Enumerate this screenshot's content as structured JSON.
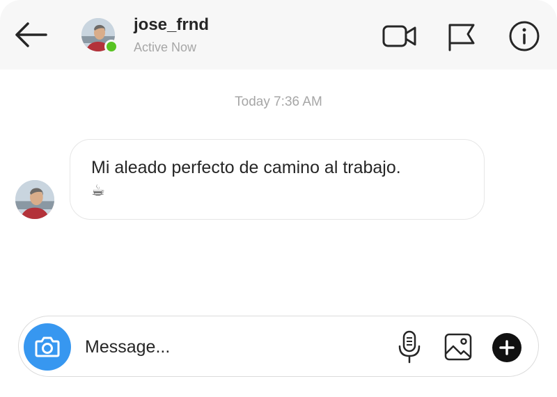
{
  "header": {
    "username": "jose_frnd",
    "status": "Active Now",
    "icons": {
      "back": "arrow-left-icon",
      "video": "video-camera-icon",
      "flag": "flag-icon",
      "info": "info-icon"
    },
    "online_color": "#58c322"
  },
  "thread": {
    "timestamp": "Today 7:36 AM",
    "messages": [
      {
        "text": "Mi aleado perfecto de camino al trabajo.",
        "emoji": "☕"
      }
    ]
  },
  "composer": {
    "placeholder": "Message...",
    "icons": {
      "camera": "camera-icon",
      "mic": "microphone-icon",
      "gallery": "image-icon",
      "add": "plus-circle-icon"
    },
    "camera_color": "#3797f0"
  }
}
